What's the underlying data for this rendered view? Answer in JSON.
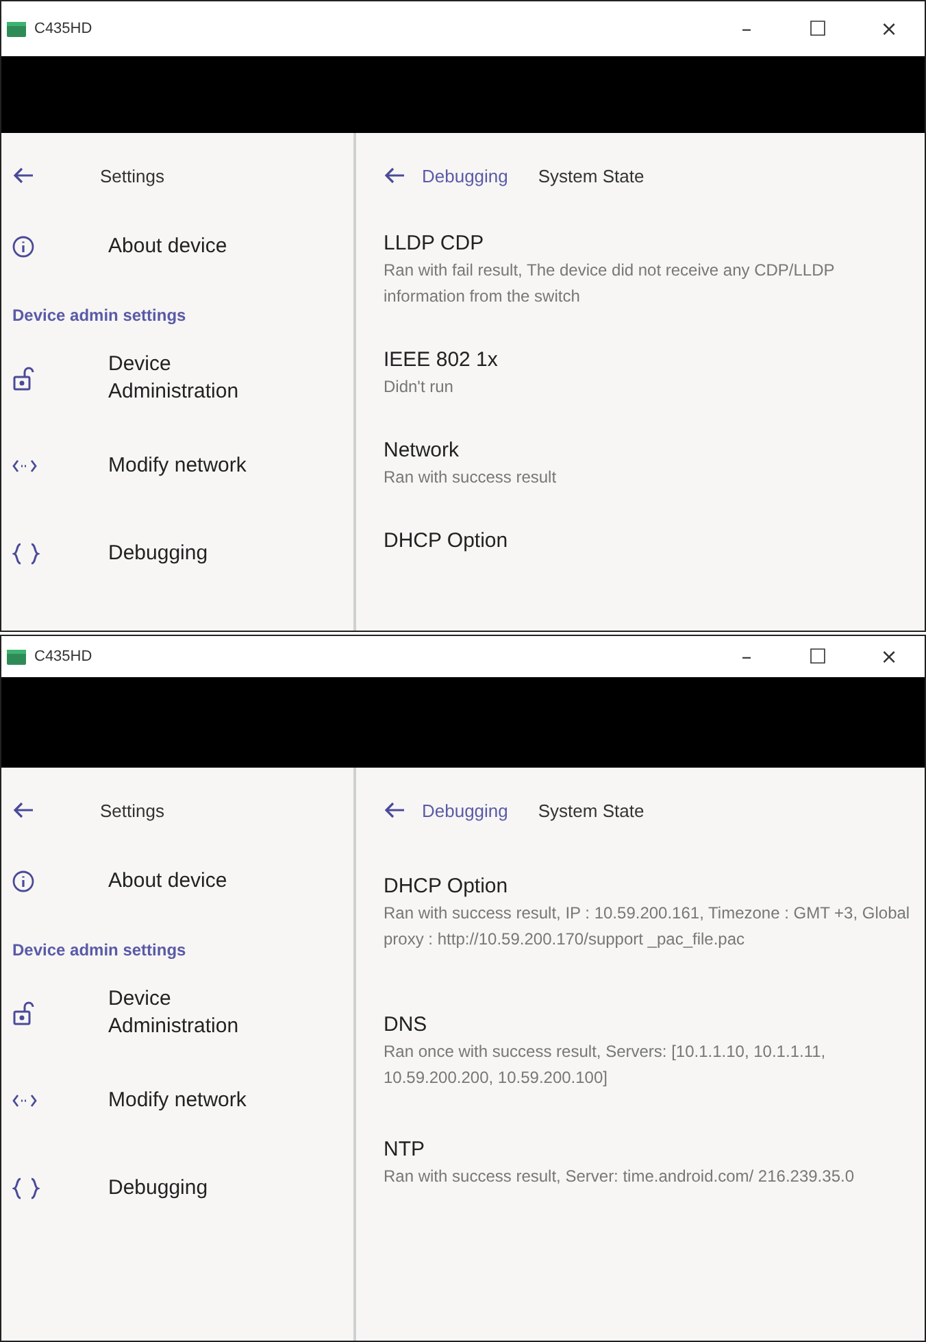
{
  "windows": [
    {
      "title": "C435HD",
      "controls": [
        "–",
        "☐",
        "×"
      ],
      "sidebar": {
        "back_label": "Settings",
        "items": [
          {
            "kind": "item",
            "label": "About device"
          },
          {
            "kind": "header",
            "label": "Device admin settings"
          },
          {
            "kind": "item",
            "label": "Device Administration"
          },
          {
            "kind": "item",
            "label": "Modify network"
          },
          {
            "kind": "item",
            "label": "Debugging"
          }
        ]
      },
      "header": {
        "breadcrumb": "Debugging",
        "title": "System State"
      },
      "entries": [
        {
          "title": "LLDP CDP",
          "detail": "Ran with fail result, The device did not receive any CDP/LLDP information from the switch"
        },
        {
          "title": "IEEE 802 1x",
          "detail": "Didn't run"
        },
        {
          "title": "Network",
          "detail": "Ran with success result"
        },
        {
          "title": "DHCP Option"
        }
      ]
    },
    {
      "title": "C435HD",
      "controls": [
        "–",
        "☐",
        "×"
      ],
      "sidebar": {
        "back_label": "Settings",
        "items": [
          {
            "kind": "item",
            "label": "About device"
          },
          {
            "kind": "header",
            "label": "Device admin settings"
          },
          {
            "kind": "item",
            "label": "Device Administration"
          },
          {
            "kind": "item",
            "label": "Modify network"
          },
          {
            "kind": "item",
            "label": "Debugging"
          }
        ]
      },
      "header": {
        "breadcrumb": "Debugging",
        "title": "System State"
      },
      "entries": [
        {
          "title": "DHCP Option",
          "detail": "Ran with success result, IP : 10.59.200.161, Timezone : GMT +3, Global proxy : http://10.59.200.170/support _pac_file.pac"
        },
        {
          "title": "DNS",
          "detail": "Ran once with success result, Servers: [10.1.1.10, 10.1.1.11, 10.59.200.200, 10.59.200.100]"
        },
        {
          "title": "NTP",
          "detail": "Ran with success result, Server: time.android.com/ 216.239.35.0"
        }
      ]
    }
  ]
}
